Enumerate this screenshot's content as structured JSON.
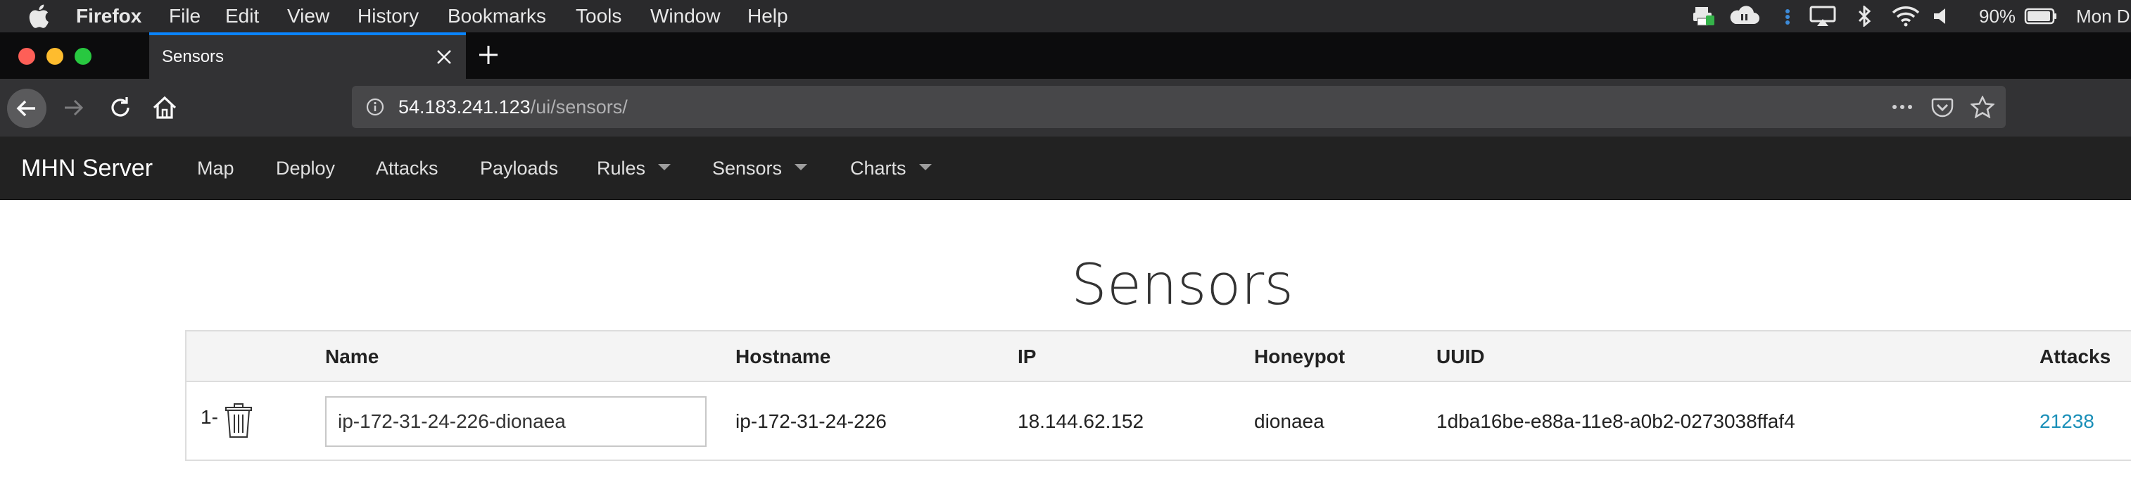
{
  "os_menubar": {
    "app_name": "Firefox",
    "items": [
      "File",
      "Edit",
      "View",
      "History",
      "Bookmarks",
      "Tools",
      "Window",
      "Help"
    ],
    "battery": "90%",
    "clock": "Mon D"
  },
  "browser": {
    "tab_title": "Sensors",
    "url_host": "54.183.241.123",
    "url_path": "/ui/sensors/"
  },
  "app_nav": {
    "brand": "MHN Server",
    "items": [
      {
        "label": "Map"
      },
      {
        "label": "Deploy"
      },
      {
        "label": "Attacks"
      },
      {
        "label": "Payloads"
      },
      {
        "label": "Rules"
      },
      {
        "label": "Sensors"
      },
      {
        "label": "Charts"
      }
    ]
  },
  "page": {
    "title": "Sensors",
    "table": {
      "headers": {
        "name": "Name",
        "hostname": "Hostname",
        "ip": "IP",
        "honeypot": "Honeypot",
        "uuid": "UUID",
        "attacks": "Attacks"
      },
      "rows": [
        {
          "index": "1-",
          "name": "ip-172-31-24-226-dionaea",
          "hostname": "ip-172-31-24-226",
          "ip": "18.144.62.152",
          "honeypot": "dionaea",
          "uuid": "1dba16be-e88a-11e8-a0b2-0273038ffaf4",
          "attacks": "21238"
        }
      ]
    }
  },
  "colors": {
    "tab_accent": "#0a84ff",
    "link": "#1a8fb8",
    "app_nav_bg": "#222222"
  }
}
